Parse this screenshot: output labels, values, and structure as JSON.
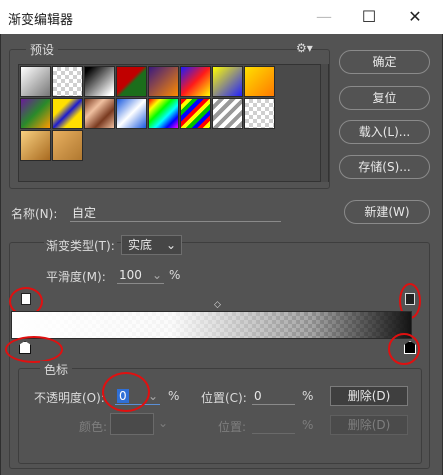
{
  "window": {
    "title": "渐变编辑器",
    "min_icon": "—",
    "max_icon": "☐",
    "close_icon": "✕"
  },
  "presets": {
    "label": "预设",
    "gear_icon": "⚙▾"
  },
  "buttons": {
    "ok": "确定",
    "reset": "复位",
    "load": "载入(L)...",
    "save": "存储(S)...",
    "new": "新建(W)"
  },
  "name": {
    "label": "名称(N):",
    "value": "自定"
  },
  "gradient_type": {
    "label": "渐变类型(T):",
    "value": "实底"
  },
  "smoothness": {
    "label": "平滑度(M):",
    "value": "100",
    "unit": "%"
  },
  "color_stop": {
    "group_label": "色标",
    "opacity_label": "不透明度(O):",
    "opacity_value": "0",
    "opacity_unit": "%",
    "location_label": "位置(C):",
    "location_value": "0",
    "location_unit": "%",
    "delete_label": "删除(D)",
    "color_label": "颜色:",
    "location2_label": "位置:",
    "location2_unit": "%",
    "delete2_label": "删除(D)"
  },
  "midpoint_icon": "◇"
}
